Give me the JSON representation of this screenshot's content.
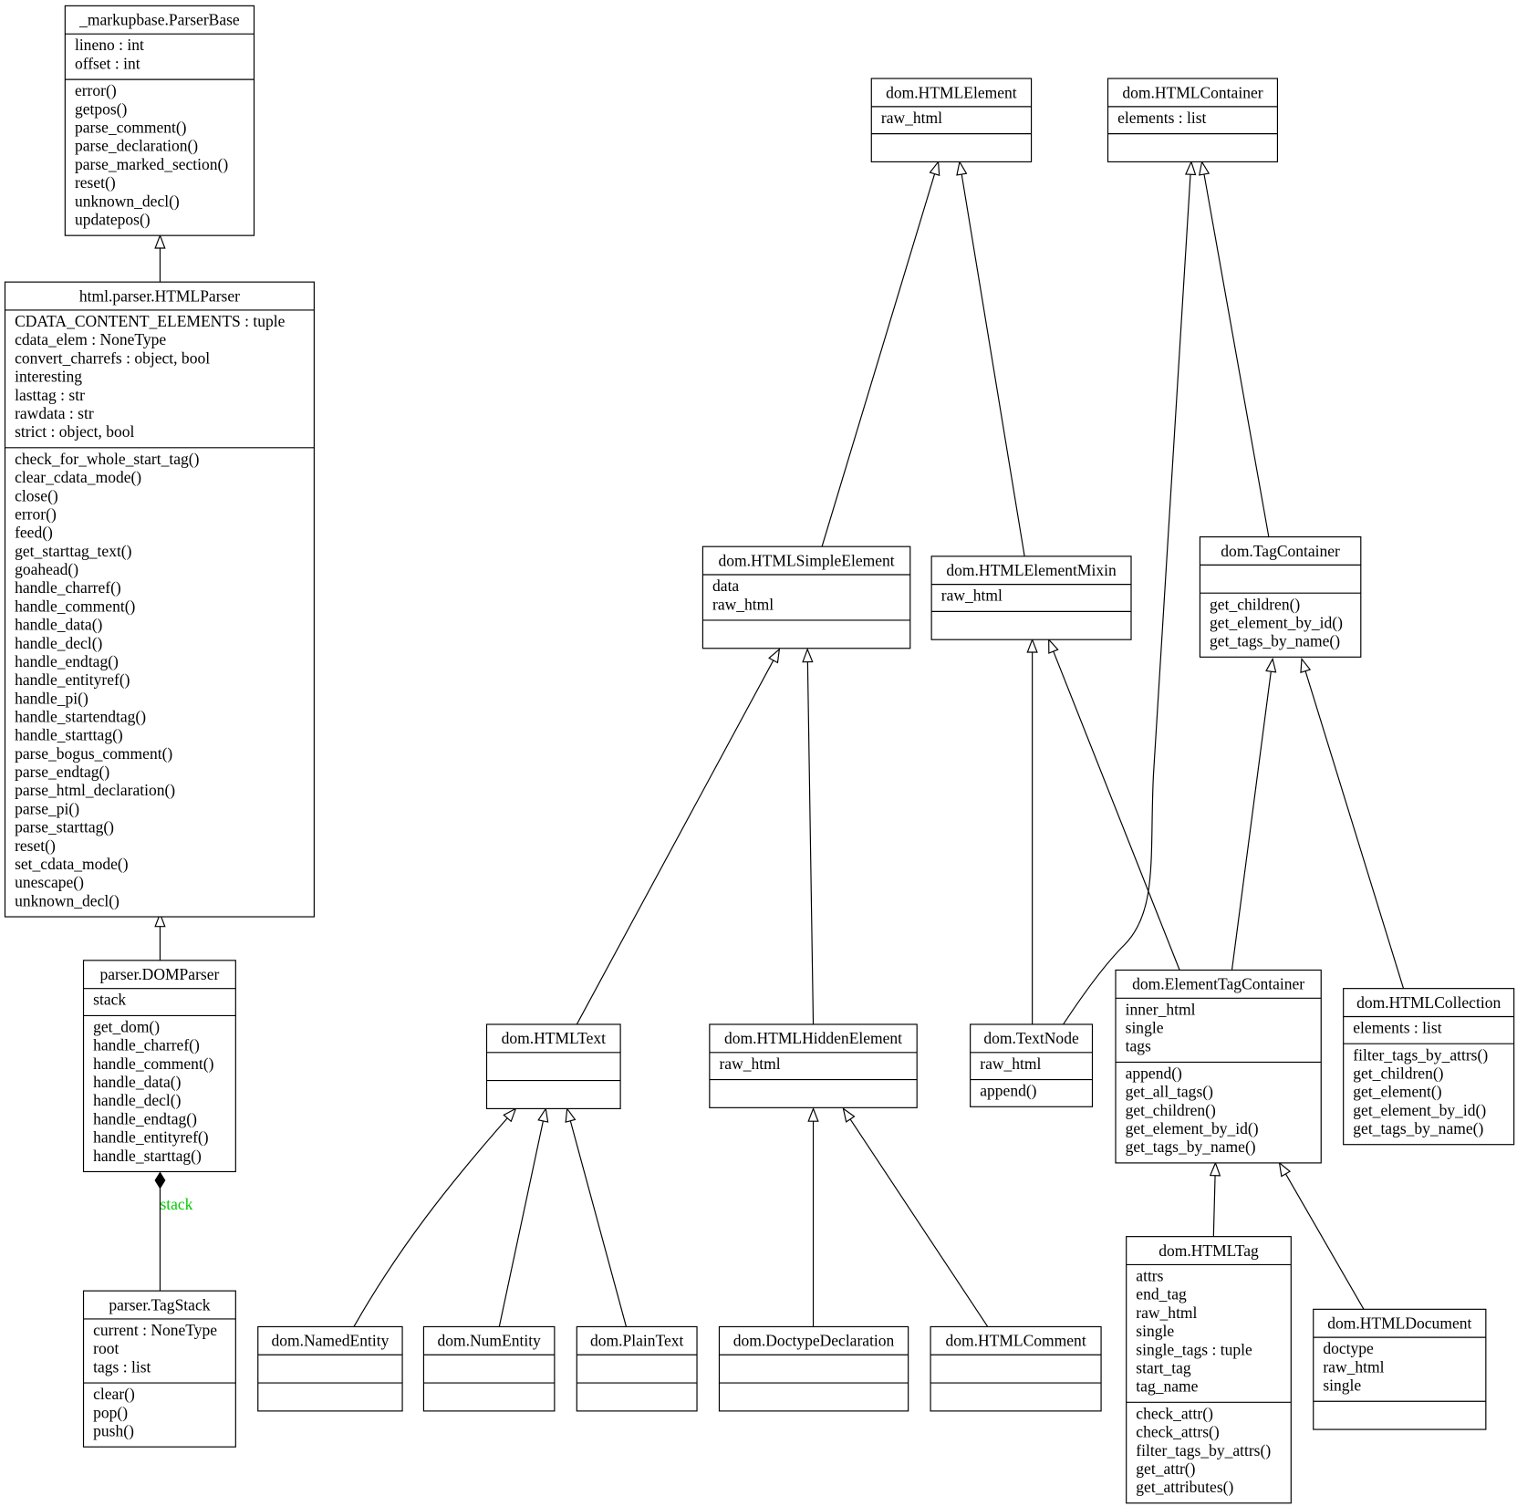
{
  "diagram_type": "uml-class-diagram",
  "classes": [
    {
      "name": "_markupbase.ParserBase",
      "attributes": [
        "lineno : int",
        "offset : int"
      ],
      "methods": [
        "error()",
        "getpos()",
        "parse_comment()",
        "parse_declaration()",
        "parse_marked_section()",
        "reset()",
        "unknown_decl()",
        "updatepos()"
      ]
    },
    {
      "name": "html.parser.HTMLParser",
      "attributes": [
        "CDATA_CONTENT_ELEMENTS : tuple",
        "cdata_elem : NoneType",
        "convert_charrefs : object, bool",
        "interesting",
        "lasttag : str",
        "rawdata : str",
        "strict : object, bool"
      ],
      "methods": [
        "check_for_whole_start_tag()",
        "clear_cdata_mode()",
        "close()",
        "error()",
        "feed()",
        "get_starttag_text()",
        "goahead()",
        "handle_charref()",
        "handle_comment()",
        "handle_data()",
        "handle_decl()",
        "handle_endtag()",
        "handle_entityref()",
        "handle_pi()",
        "handle_startendtag()",
        "handle_starttag()",
        "parse_bogus_comment()",
        "parse_endtag()",
        "parse_html_declaration()",
        "parse_pi()",
        "parse_starttag()",
        "reset()",
        "set_cdata_mode()",
        "unescape()",
        "unknown_decl()"
      ]
    },
    {
      "name": "parser.DOMParser",
      "attributes": [
        "stack"
      ],
      "methods": [
        "get_dom()",
        "handle_charref()",
        "handle_comment()",
        "handle_data()",
        "handle_decl()",
        "handle_endtag()",
        "handle_entityref()",
        "handle_starttag()"
      ]
    },
    {
      "name": "parser.TagStack",
      "attributes": [
        "current : NoneType",
        "root",
        "tags : list"
      ],
      "methods": [
        "clear()",
        "pop()",
        "push()"
      ]
    },
    {
      "name": "dom.HTMLElement",
      "attributes": [
        "raw_html"
      ],
      "methods": []
    },
    {
      "name": "dom.HTMLContainer",
      "attributes": [
        "elements : list"
      ],
      "methods": []
    },
    {
      "name": "dom.HTMLSimpleElement",
      "attributes": [
        "data",
        "raw_html"
      ],
      "methods": []
    },
    {
      "name": "dom.HTMLElementMixin",
      "attributes": [
        "raw_html"
      ],
      "methods": []
    },
    {
      "name": "dom.TagContainer",
      "attributes": [],
      "methods": [
        "get_children()",
        "get_element_by_id()",
        "get_tags_by_name()"
      ]
    },
    {
      "name": "dom.HTMLText",
      "attributes": [],
      "methods": []
    },
    {
      "name": "dom.HTMLHiddenElement",
      "attributes": [
        "raw_html"
      ],
      "methods": []
    },
    {
      "name": "dom.TextNode",
      "attributes": [
        "raw_html"
      ],
      "methods": [
        "append()"
      ]
    },
    {
      "name": "dom.ElementTagContainer",
      "attributes": [
        "inner_html",
        "single",
        "tags"
      ],
      "methods": [
        "append()",
        "get_all_tags()",
        "get_children()",
        "get_element_by_id()",
        "get_tags_by_name()"
      ]
    },
    {
      "name": "dom.HTMLCollection",
      "attributes": [
        "elements : list"
      ],
      "methods": [
        "filter_tags_by_attrs()",
        "get_children()",
        "get_element()",
        "get_element_by_id()",
        "get_tags_by_name()"
      ]
    },
    {
      "name": "dom.NamedEntity",
      "attributes": [],
      "methods": []
    },
    {
      "name": "dom.NumEntity",
      "attributes": [],
      "methods": []
    },
    {
      "name": "dom.PlainText",
      "attributes": [],
      "methods": []
    },
    {
      "name": "dom.DoctypeDeclaration",
      "attributes": [],
      "methods": []
    },
    {
      "name": "dom.HTMLComment",
      "attributes": [],
      "methods": []
    },
    {
      "name": "dom.HTMLTag",
      "attributes": [
        "attrs",
        "end_tag",
        "raw_html",
        "single",
        "single_tags : tuple",
        "start_tag",
        "tag_name"
      ],
      "methods": [
        "check_attr()",
        "check_attrs()",
        "filter_tags_by_attrs()",
        "get_attr()",
        "get_attributes()"
      ]
    },
    {
      "name": "dom.HTMLDocument",
      "attributes": [
        "doctype",
        "raw_html",
        "single"
      ],
      "methods": []
    }
  ],
  "relationships": [
    {
      "type": "inheritance",
      "child": "html.parser.HTMLParser",
      "parent": "_markupbase.ParserBase"
    },
    {
      "type": "inheritance",
      "child": "parser.DOMParser",
      "parent": "html.parser.HTMLParser"
    },
    {
      "type": "composition",
      "part": "parser.TagStack",
      "whole": "parser.DOMParser",
      "label": "stack",
      "label_color": "#00cc00"
    },
    {
      "type": "inheritance",
      "child": "dom.HTMLSimpleElement",
      "parent": "dom.HTMLElement"
    },
    {
      "type": "inheritance",
      "child": "dom.HTMLElementMixin",
      "parent": "dom.HTMLElement"
    },
    {
      "type": "inheritance",
      "child": "dom.TagContainer",
      "parent": "dom.HTMLContainer"
    },
    {
      "type": "inheritance",
      "child": "dom.TextNode",
      "parent": "dom.HTMLContainer"
    },
    {
      "type": "inheritance",
      "child": "dom.HTMLText",
      "parent": "dom.HTMLSimpleElement"
    },
    {
      "type": "inheritance",
      "child": "dom.HTMLHiddenElement",
      "parent": "dom.HTMLSimpleElement"
    },
    {
      "type": "inheritance",
      "child": "dom.TextNode",
      "parent": "dom.HTMLElementMixin"
    },
    {
      "type": "inheritance",
      "child": "dom.ElementTagContainer",
      "parent": "dom.HTMLElementMixin"
    },
    {
      "type": "inheritance",
      "child": "dom.ElementTagContainer",
      "parent": "dom.TagContainer"
    },
    {
      "type": "inheritance",
      "child": "dom.HTMLCollection",
      "parent": "dom.TagContainer"
    },
    {
      "type": "inheritance",
      "child": "dom.NamedEntity",
      "parent": "dom.HTMLText"
    },
    {
      "type": "inheritance",
      "child": "dom.NumEntity",
      "parent": "dom.HTMLText"
    },
    {
      "type": "inheritance",
      "child": "dom.PlainText",
      "parent": "dom.HTMLText"
    },
    {
      "type": "inheritance",
      "child": "dom.DoctypeDeclaration",
      "parent": "dom.HTMLHiddenElement"
    },
    {
      "type": "inheritance",
      "child": "dom.HTMLComment",
      "parent": "dom.HTMLHiddenElement"
    },
    {
      "type": "inheritance",
      "child": "dom.HTMLTag",
      "parent": "dom.ElementTagContainer"
    },
    {
      "type": "inheritance",
      "child": "dom.HTMLDocument",
      "parent": "dom.ElementTagContainer"
    }
  ]
}
